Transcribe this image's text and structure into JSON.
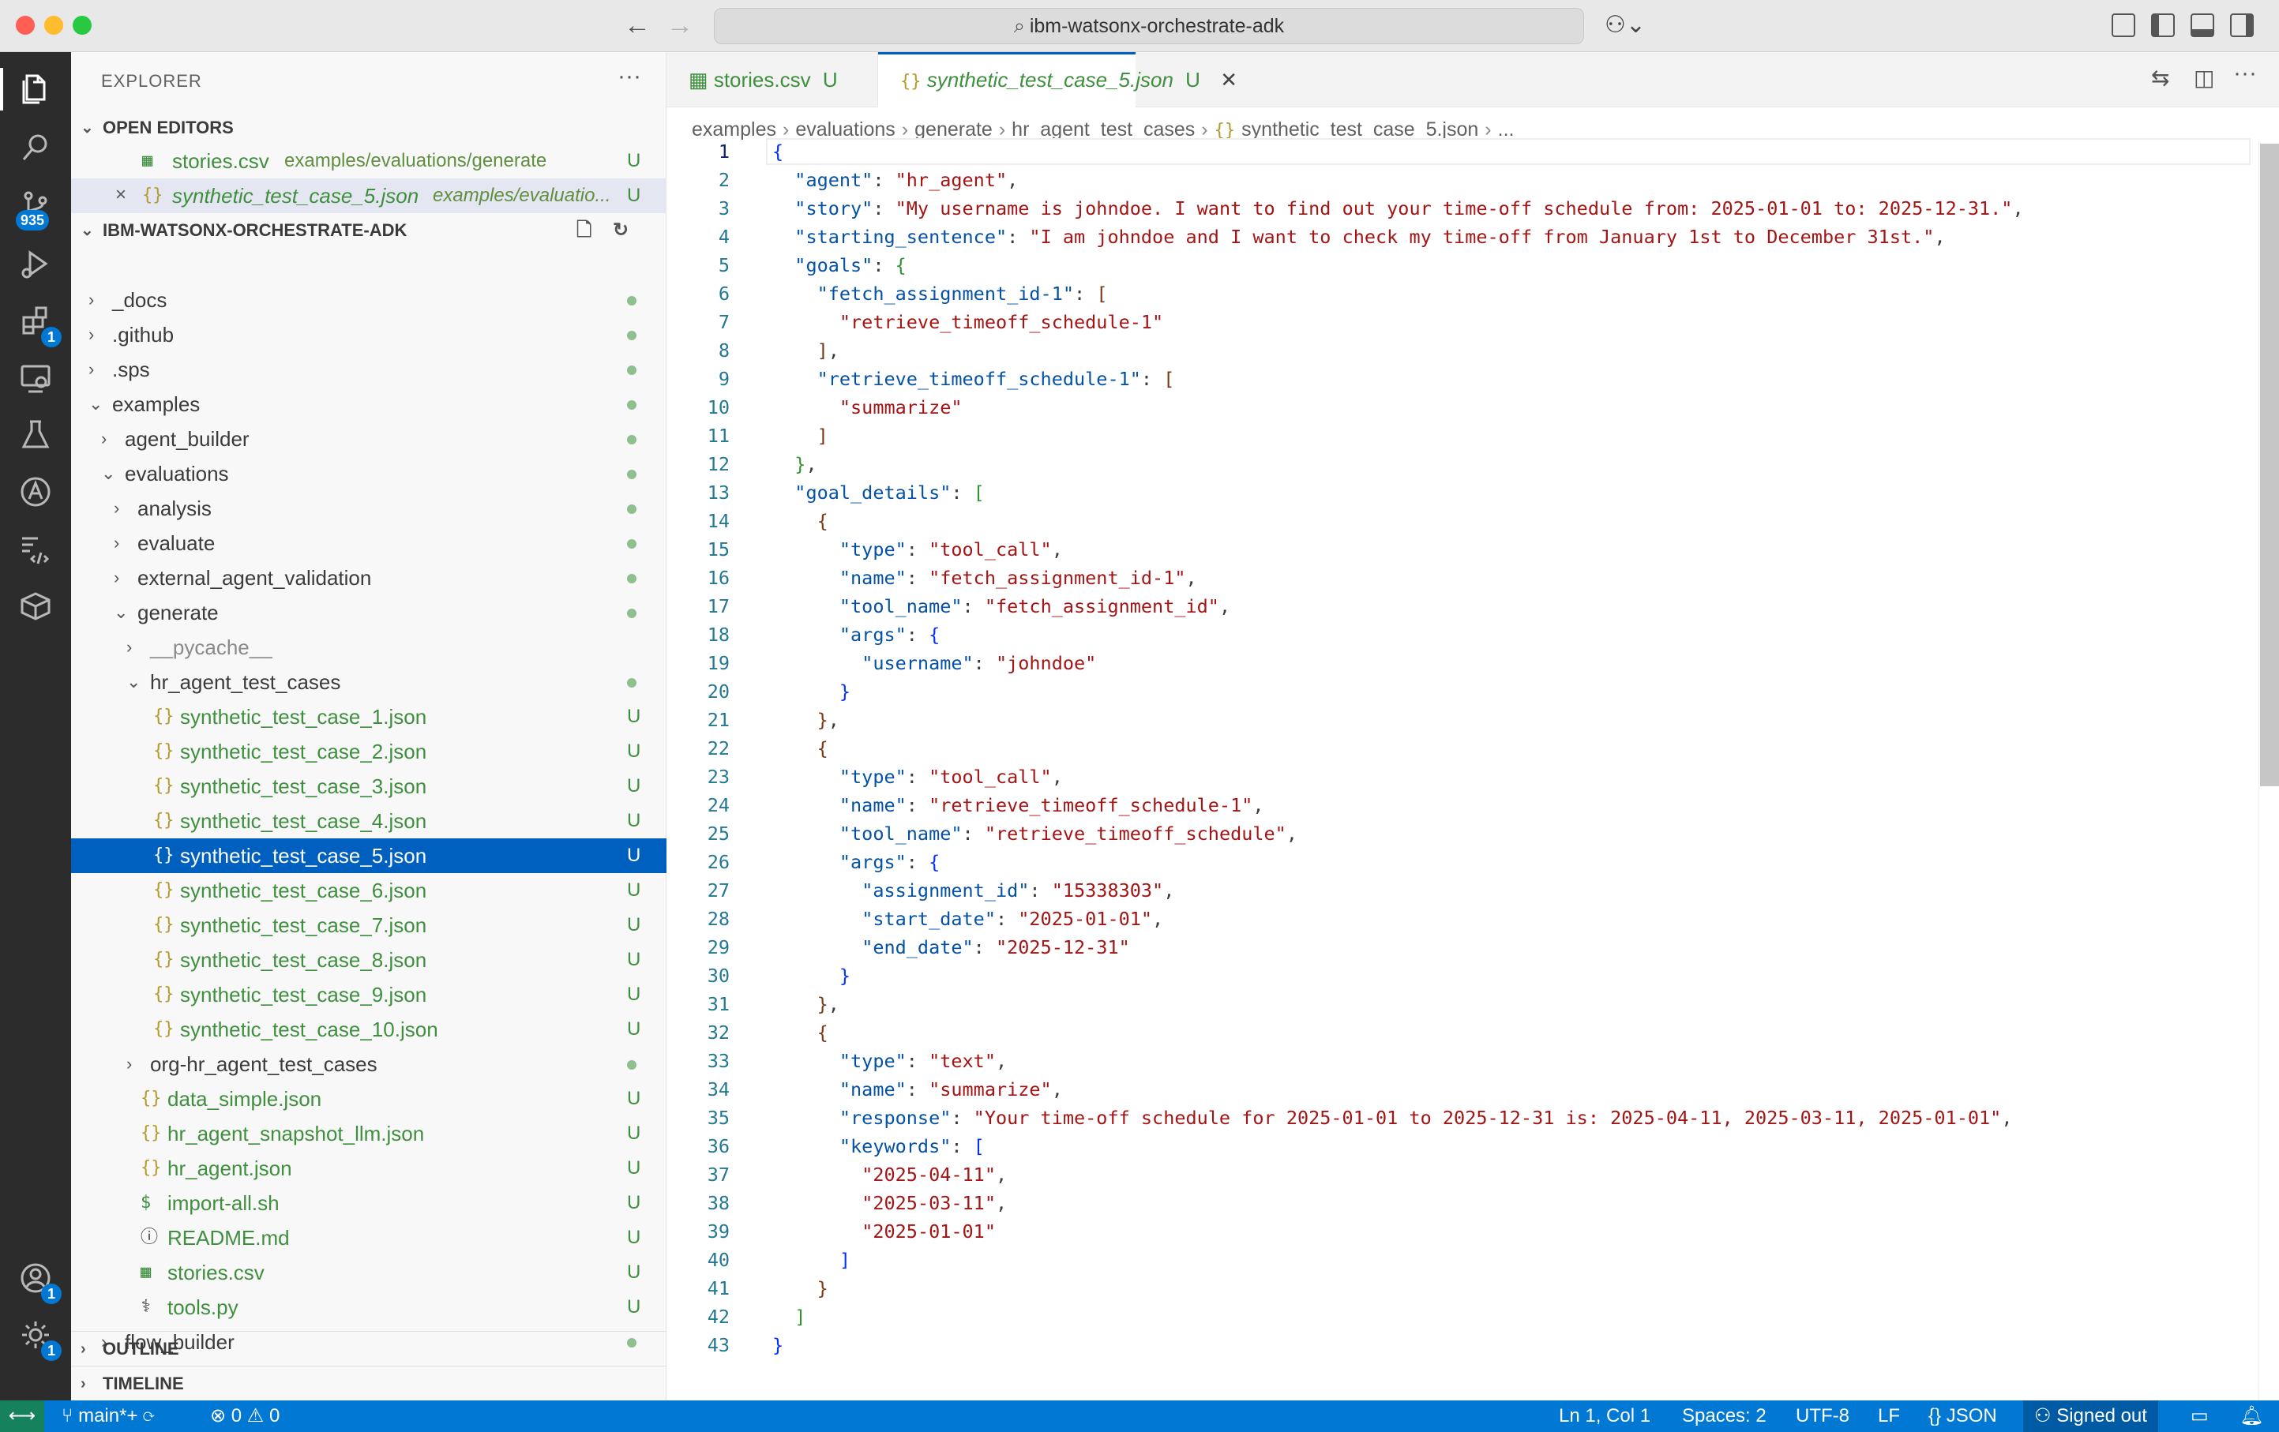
{
  "titlebar": {
    "search_text": "ibm-watsonx-orchestrate-adk"
  },
  "activity": {
    "scm_badge": "935",
    "extensions_badge": "1",
    "accounts_badge": "1",
    "settings_badge": "1"
  },
  "sidebar": {
    "title": "EXPLORER",
    "open_editors_label": "OPEN EDITORS",
    "open_editors": [
      {
        "name": "stories.csv",
        "path": "examples/evaluations/generate",
        "status": "U"
      },
      {
        "name": "synthetic_test_case_5.json",
        "path": "examples/evaluatio...",
        "status": "U"
      }
    ],
    "workspace_label": "IBM-WATSONX-ORCHESTRATE-ADK",
    "tree": [
      {
        "name": "_docs"
      },
      {
        "name": ".github"
      },
      {
        "name": ".sps"
      },
      {
        "name": "examples"
      },
      {
        "name": "agent_builder"
      },
      {
        "name": "evaluations"
      },
      {
        "name": "analysis"
      },
      {
        "name": "evaluate"
      },
      {
        "name": "external_agent_validation"
      },
      {
        "name": "generate"
      },
      {
        "name": "__pycache__"
      },
      {
        "name": "hr_agent_test_cases"
      },
      {
        "name": "synthetic_test_case_1.json",
        "status": "U"
      },
      {
        "name": "synthetic_test_case_2.json",
        "status": "U"
      },
      {
        "name": "synthetic_test_case_3.json",
        "status": "U"
      },
      {
        "name": "synthetic_test_case_4.json",
        "status": "U"
      },
      {
        "name": "synthetic_test_case_5.json",
        "status": "U"
      },
      {
        "name": "synthetic_test_case_6.json",
        "status": "U"
      },
      {
        "name": "synthetic_test_case_7.json",
        "status": "U"
      },
      {
        "name": "synthetic_test_case_8.json",
        "status": "U"
      },
      {
        "name": "synthetic_test_case_9.json",
        "status": "U"
      },
      {
        "name": "synthetic_test_case_10.json",
        "status": "U"
      },
      {
        "name": "org-hr_agent_test_cases"
      },
      {
        "name": "data_simple.json",
        "status": "U"
      },
      {
        "name": "hr_agent_snapshot_llm.json",
        "status": "U"
      },
      {
        "name": "hr_agent.json",
        "status": "U"
      },
      {
        "name": "import-all.sh",
        "status": "U"
      },
      {
        "name": "README.md",
        "status": "U"
      },
      {
        "name": "stories.csv",
        "status": "U"
      },
      {
        "name": "tools.py",
        "status": "U"
      },
      {
        "name": "flow_builder"
      }
    ],
    "outline_label": "OUTLINE",
    "timeline_label": "TIMELINE"
  },
  "tabs": [
    {
      "name": "stories.csv",
      "status": "U"
    },
    {
      "name": "synthetic_test_case_5.json",
      "status": "U"
    }
  ],
  "breadcrumb": [
    "examples",
    "evaluations",
    "generate",
    "hr_agent_test_cases",
    "synthetic_test_case_5.json",
    "..."
  ],
  "code_lines": [
    [
      [
        "p1",
        "{"
      ]
    ],
    [
      [
        "",
        "  "
      ],
      [
        "k",
        "\"agent\""
      ],
      [
        "",
        ": "
      ],
      [
        "s",
        "\"hr_agent\""
      ],
      [
        "",
        ","
      ]
    ],
    [
      [
        "",
        "  "
      ],
      [
        "k",
        "\"story\""
      ],
      [
        "",
        ": "
      ],
      [
        "s",
        "\"My username is johndoe. I want to find out your time-off schedule from: 2025-01-01 to: 2025-12-31.\""
      ],
      [
        "",
        ","
      ]
    ],
    [
      [
        "",
        "  "
      ],
      [
        "k",
        "\"starting_sentence\""
      ],
      [
        "",
        ": "
      ],
      [
        "s",
        "\"I am johndoe and I want to check my time-off from January 1st to December 31st.\""
      ],
      [
        "",
        ","
      ]
    ],
    [
      [
        "",
        "  "
      ],
      [
        "k",
        "\"goals\""
      ],
      [
        "",
        ": "
      ],
      [
        "p2",
        "{"
      ]
    ],
    [
      [
        "",
        "    "
      ],
      [
        "k",
        "\"fetch_assignment_id-1\""
      ],
      [
        "",
        ": "
      ],
      [
        "p3",
        "["
      ]
    ],
    [
      [
        "",
        "      "
      ],
      [
        "s",
        "\"retrieve_timeoff_schedule-1\""
      ]
    ],
    [
      [
        "",
        "    "
      ],
      [
        "p3",
        "]"
      ],
      [
        "",
        ","
      ]
    ],
    [
      [
        "",
        "    "
      ],
      [
        "k",
        "\"retrieve_timeoff_schedule-1\""
      ],
      [
        "",
        ": "
      ],
      [
        "p3",
        "["
      ]
    ],
    [
      [
        "",
        "      "
      ],
      [
        "s",
        "\"summarize\""
      ]
    ],
    [
      [
        "",
        "    "
      ],
      [
        "p3",
        "]"
      ]
    ],
    [
      [
        "",
        "  "
      ],
      [
        "p2",
        "}"
      ],
      [
        "",
        ","
      ]
    ],
    [
      [
        "",
        "  "
      ],
      [
        "k",
        "\"goal_details\""
      ],
      [
        "",
        ": "
      ],
      [
        "p2",
        "["
      ]
    ],
    [
      [
        "",
        "    "
      ],
      [
        "p3",
        "{"
      ]
    ],
    [
      [
        "",
        "      "
      ],
      [
        "k",
        "\"type\""
      ],
      [
        "",
        ": "
      ],
      [
        "s",
        "\"tool_call\""
      ],
      [
        "",
        ","
      ]
    ],
    [
      [
        "",
        "      "
      ],
      [
        "k",
        "\"name\""
      ],
      [
        "",
        ": "
      ],
      [
        "s",
        "\"fetch_assignment_id-1\""
      ],
      [
        "",
        ","
      ]
    ],
    [
      [
        "",
        "      "
      ],
      [
        "k",
        "\"tool_name\""
      ],
      [
        "",
        ": "
      ],
      [
        "s",
        "\"fetch_assignment_id\""
      ],
      [
        "",
        ","
      ]
    ],
    [
      [
        "",
        "      "
      ],
      [
        "k",
        "\"args\""
      ],
      [
        "",
        ": "
      ],
      [
        "p1",
        "{"
      ]
    ],
    [
      [
        "",
        "        "
      ],
      [
        "k",
        "\"username\""
      ],
      [
        "",
        ": "
      ],
      [
        "s",
        "\"johndoe\""
      ]
    ],
    [
      [
        "",
        "      "
      ],
      [
        "p1",
        "}"
      ]
    ],
    [
      [
        "",
        "    "
      ],
      [
        "p3",
        "}"
      ],
      [
        "",
        ","
      ]
    ],
    [
      [
        "",
        "    "
      ],
      [
        "p3",
        "{"
      ]
    ],
    [
      [
        "",
        "      "
      ],
      [
        "k",
        "\"type\""
      ],
      [
        "",
        ": "
      ],
      [
        "s",
        "\"tool_call\""
      ],
      [
        "",
        ","
      ]
    ],
    [
      [
        "",
        "      "
      ],
      [
        "k",
        "\"name\""
      ],
      [
        "",
        ": "
      ],
      [
        "s",
        "\"retrieve_timeoff_schedule-1\""
      ],
      [
        "",
        ","
      ]
    ],
    [
      [
        "",
        "      "
      ],
      [
        "k",
        "\"tool_name\""
      ],
      [
        "",
        ": "
      ],
      [
        "s",
        "\"retrieve_timeoff_schedule\""
      ],
      [
        "",
        ","
      ]
    ],
    [
      [
        "",
        "      "
      ],
      [
        "k",
        "\"args\""
      ],
      [
        "",
        ": "
      ],
      [
        "p1",
        "{"
      ]
    ],
    [
      [
        "",
        "        "
      ],
      [
        "k",
        "\"assignment_id\""
      ],
      [
        "",
        ": "
      ],
      [
        "s",
        "\"15338303\""
      ],
      [
        "",
        ","
      ]
    ],
    [
      [
        "",
        "        "
      ],
      [
        "k",
        "\"start_date\""
      ],
      [
        "",
        ": "
      ],
      [
        "s",
        "\"2025-01-01\""
      ],
      [
        "",
        ","
      ]
    ],
    [
      [
        "",
        "        "
      ],
      [
        "k",
        "\"end_date\""
      ],
      [
        "",
        ": "
      ],
      [
        "s",
        "\"2025-12-31\""
      ]
    ],
    [
      [
        "",
        "      "
      ],
      [
        "p1",
        "}"
      ]
    ],
    [
      [
        "",
        "    "
      ],
      [
        "p3",
        "}"
      ],
      [
        "",
        ","
      ]
    ],
    [
      [
        "",
        "    "
      ],
      [
        "p3",
        "{"
      ]
    ],
    [
      [
        "",
        "      "
      ],
      [
        "k",
        "\"type\""
      ],
      [
        "",
        ": "
      ],
      [
        "s",
        "\"text\""
      ],
      [
        "",
        ","
      ]
    ],
    [
      [
        "",
        "      "
      ],
      [
        "k",
        "\"name\""
      ],
      [
        "",
        ": "
      ],
      [
        "s",
        "\"summarize\""
      ],
      [
        "",
        ","
      ]
    ],
    [
      [
        "",
        "      "
      ],
      [
        "k",
        "\"response\""
      ],
      [
        "",
        ": "
      ],
      [
        "s",
        "\"Your time-off schedule for 2025-01-01 to 2025-12-31 is: 2025-04-11, 2025-03-11, 2025-01-01\""
      ],
      [
        "",
        ","
      ]
    ],
    [
      [
        "",
        "      "
      ],
      [
        "k",
        "\"keywords\""
      ],
      [
        "",
        ": "
      ],
      [
        "p1",
        "["
      ]
    ],
    [
      [
        "",
        "        "
      ],
      [
        "s",
        "\"2025-04-11\""
      ],
      [
        "",
        ","
      ]
    ],
    [
      [
        "",
        "        "
      ],
      [
        "s",
        "\"2025-03-11\""
      ],
      [
        "",
        ","
      ]
    ],
    [
      [
        "",
        "        "
      ],
      [
        "s",
        "\"2025-01-01\""
      ]
    ],
    [
      [
        "",
        "      "
      ],
      [
        "p1",
        "]"
      ]
    ],
    [
      [
        "",
        "    "
      ],
      [
        "p3",
        "}"
      ]
    ],
    [
      [
        "",
        "  "
      ],
      [
        "p2",
        "]"
      ]
    ],
    [
      [
        "p1",
        "}"
      ]
    ]
  ],
  "status": {
    "branch": "main*+",
    "errors": "0",
    "warnings": "0",
    "position": "Ln 1, Col 1",
    "spaces": "Spaces: 2",
    "encoding": "UTF-8",
    "eol": "LF",
    "language": "JSON",
    "account": "Signed out"
  }
}
